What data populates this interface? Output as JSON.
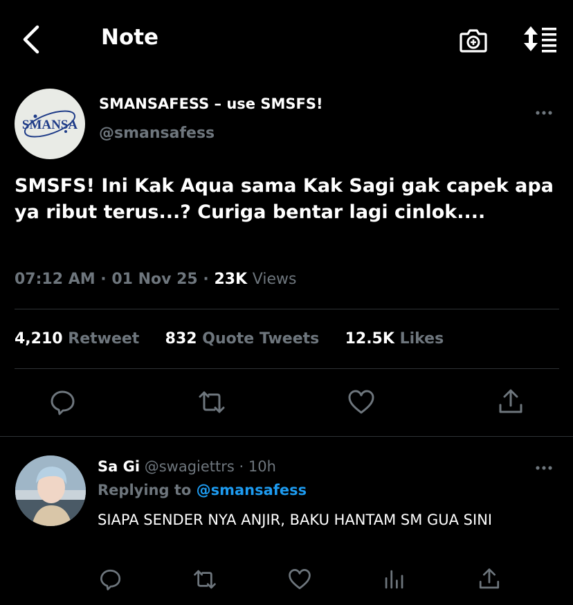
{
  "header": {
    "title": "Note",
    "back_icon": "back-arrow-icon",
    "camera_icon": "camera-icon",
    "sort_icon": "sort-icon"
  },
  "tweet": {
    "avatar_text": "SMANSA",
    "author_name": "SMANSAFESS – use SMSFS!",
    "author_handle": "@smansafess",
    "text": "SMSFS! Ini Kak Aqua sama Kak Sagi gak capek apa ya ribut terus...? Curiga bentar lagi cinlok....",
    "time": "07:12 AM",
    "date": "01 Nov 25",
    "views_count": "23K",
    "views_label": "Views",
    "stats": [
      {
        "count": "4,210",
        "label": "Retweet"
      },
      {
        "count": "832",
        "label": "Quote Tweets"
      },
      {
        "count": "12.5K",
        "label": "Likes"
      }
    ],
    "actions": [
      "reply-icon",
      "retweet-icon",
      "like-icon",
      "share-icon"
    ]
  },
  "reply": {
    "name": "Sa Gi",
    "handle": "@swagiettrs",
    "time": "10h",
    "replying_label": "Replying to",
    "replying_to": "@smansafess",
    "text": "SIAPA SENDER NYA ANJIR, BAKU HANTAM SM GUA SINI",
    "actions": [
      "reply-icon",
      "retweet-icon",
      "like-icon",
      "analytics-icon",
      "share-icon"
    ]
  },
  "colors": {
    "background": "#000000",
    "muted": "#6e767d",
    "link": "#1d9bf0",
    "divider": "#2f3336",
    "logo_blue": "#1f3c88"
  }
}
